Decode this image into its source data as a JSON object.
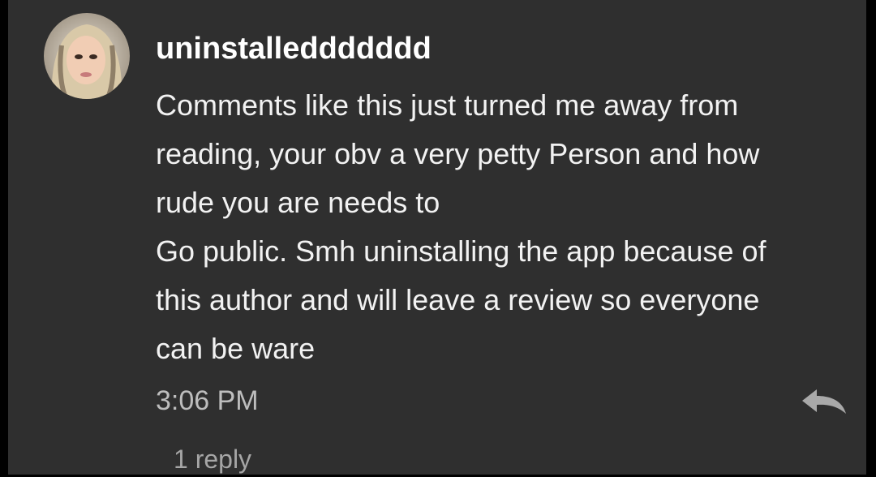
{
  "comment": {
    "author": {
      "username": "uninstalleddddddd",
      "avatar_icon": "user-avatar-photo"
    },
    "body_lines": [
      "Comments like this just turned me away from",
      "reading, your obv a very petty Person and how",
      "rude you are needs to",
      "Go public. Smh uninstalling the app because of",
      "this author and will leave a review so everyone",
      "can be ware"
    ],
    "timestamp": "3:06 PM",
    "reply_icon": "reply-arrow-icon",
    "reply_count_label": "1 reply"
  },
  "colors": {
    "background": "#2f2f2f",
    "text": "#ffffff",
    "muted_text": "#bdbdbd"
  }
}
